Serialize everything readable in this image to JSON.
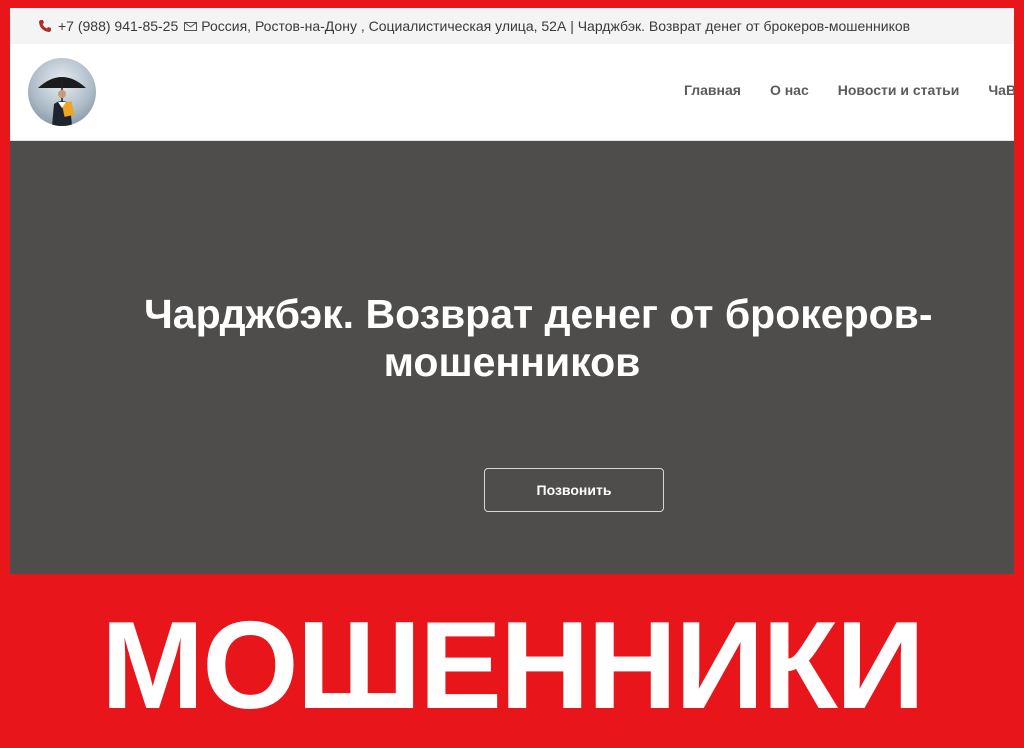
{
  "topbar": {
    "phone": "+7 (988) 941-85-25",
    "address_title": "Россия, Ростов-на-Дону , Социалистическая улица, 52А | Чарджбэк. Возврат денег от брокеров-мошенников"
  },
  "nav": {
    "items": [
      "Главная",
      "О нас",
      "Новости и статьи",
      "ЧаВо"
    ]
  },
  "hero": {
    "title_line1": "Чарджбэк. Возврат денег от брокеров-",
    "title_line2": "мошенников",
    "button_label": "Позвонить"
  },
  "banner": {
    "text": "МОШЕННИКИ"
  },
  "colors": {
    "frame_red": "#e8151b",
    "hero_bg": "#4e4d4b",
    "nav_text": "#5b5b5b"
  },
  "icons": [
    "phone-icon",
    "mail-icon"
  ]
}
